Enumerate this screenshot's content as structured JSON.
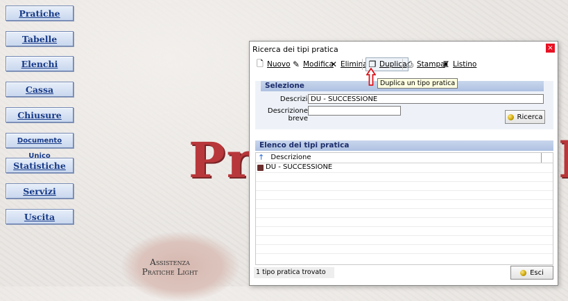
{
  "menu": {
    "items": [
      "Pratiche",
      "Tabelle",
      "Elenchi",
      "Cassa",
      "Chiusure",
      "Documento Unico",
      "Statistiche",
      "Servizi",
      "Uscita"
    ]
  },
  "background": {
    "logo_fragment_left": "Pr",
    "logo_fragment_right": "h",
    "assist_line1": "Assistenza",
    "assist_line2": "Pratiche Light"
  },
  "dialog": {
    "title": "Ricerca dei tipi pratica",
    "close": "×",
    "toolbar": {
      "nuovo": "Nuovo",
      "modifica": "Modifica",
      "elimina": "Elimina",
      "duplica": "Duplica",
      "stampa": "Stampa",
      "listino": "Listino"
    },
    "tooltip": "Duplica un tipo pratica",
    "selezione": {
      "header": "Selezione",
      "descrizione_label": "Descrizione",
      "descrizione_value": "DU - SUCCESSIONE",
      "descrizione_breve_label": "Descrizione breve",
      "descrizione_breve_value": "",
      "ricerca_button": "Ricerca"
    },
    "elenco": {
      "header": "Elenco dei tipi pratica",
      "column": "Descrizione",
      "rows": [
        "DU - SUCCESSIONE"
      ]
    },
    "status": "1 tipo pratica trovato",
    "esci_button": "Esci"
  },
  "colors": {
    "menu_text": "#173a88",
    "section_header": "#aec1e2",
    "logo_red": "#b8373a",
    "close_red": "#e81123",
    "arrow_red": "#d9161c"
  }
}
